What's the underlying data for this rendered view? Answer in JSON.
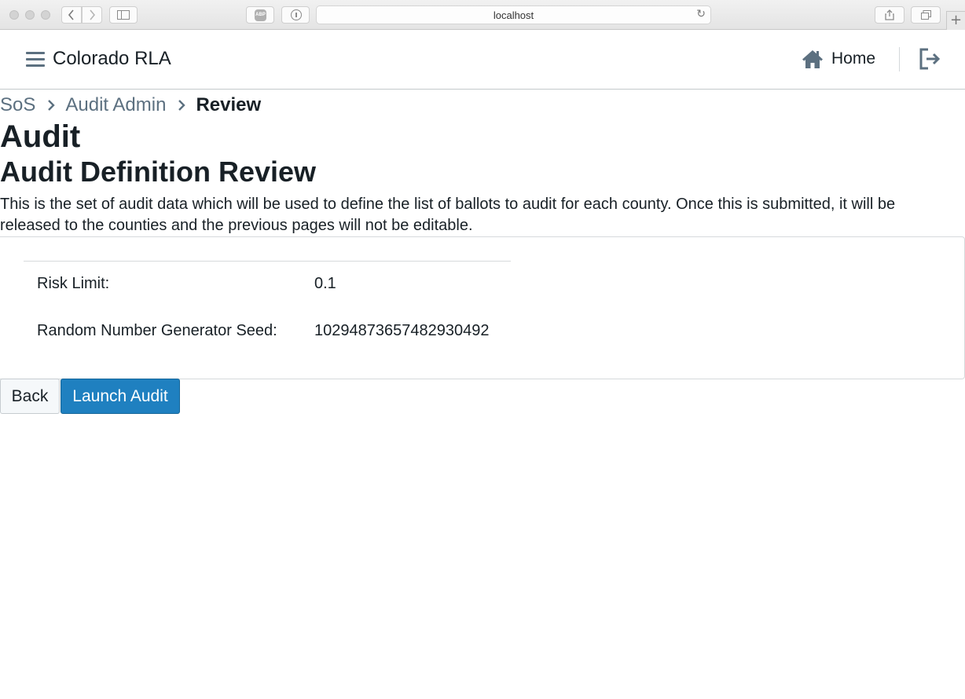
{
  "browser": {
    "url": "localhost",
    "abp_label": "ABP"
  },
  "navbar": {
    "brand": "Colorado RLA",
    "home_label": "Home"
  },
  "breadcrumb": {
    "items": [
      "SoS",
      "Audit Admin"
    ],
    "current": "Review"
  },
  "page": {
    "title": "Audit",
    "subtitle": "Audit Definition Review",
    "explanation": "This is the set of audit data which will be used to define the list of ballots to audit for each county. Once this is submitted, it will be released to the counties and the previous pages will not be editable."
  },
  "review": {
    "risk_limit_label": "Risk Limit:",
    "risk_limit_value": "0.1",
    "seed_label": "Random Number Generator Seed:",
    "seed_value": "10294873657482930492"
  },
  "buttons": {
    "back": "Back",
    "launch": "Launch Audit"
  },
  "colors": {
    "accent": "#1f80c0",
    "muted": "#5c7080",
    "text": "#182026"
  }
}
